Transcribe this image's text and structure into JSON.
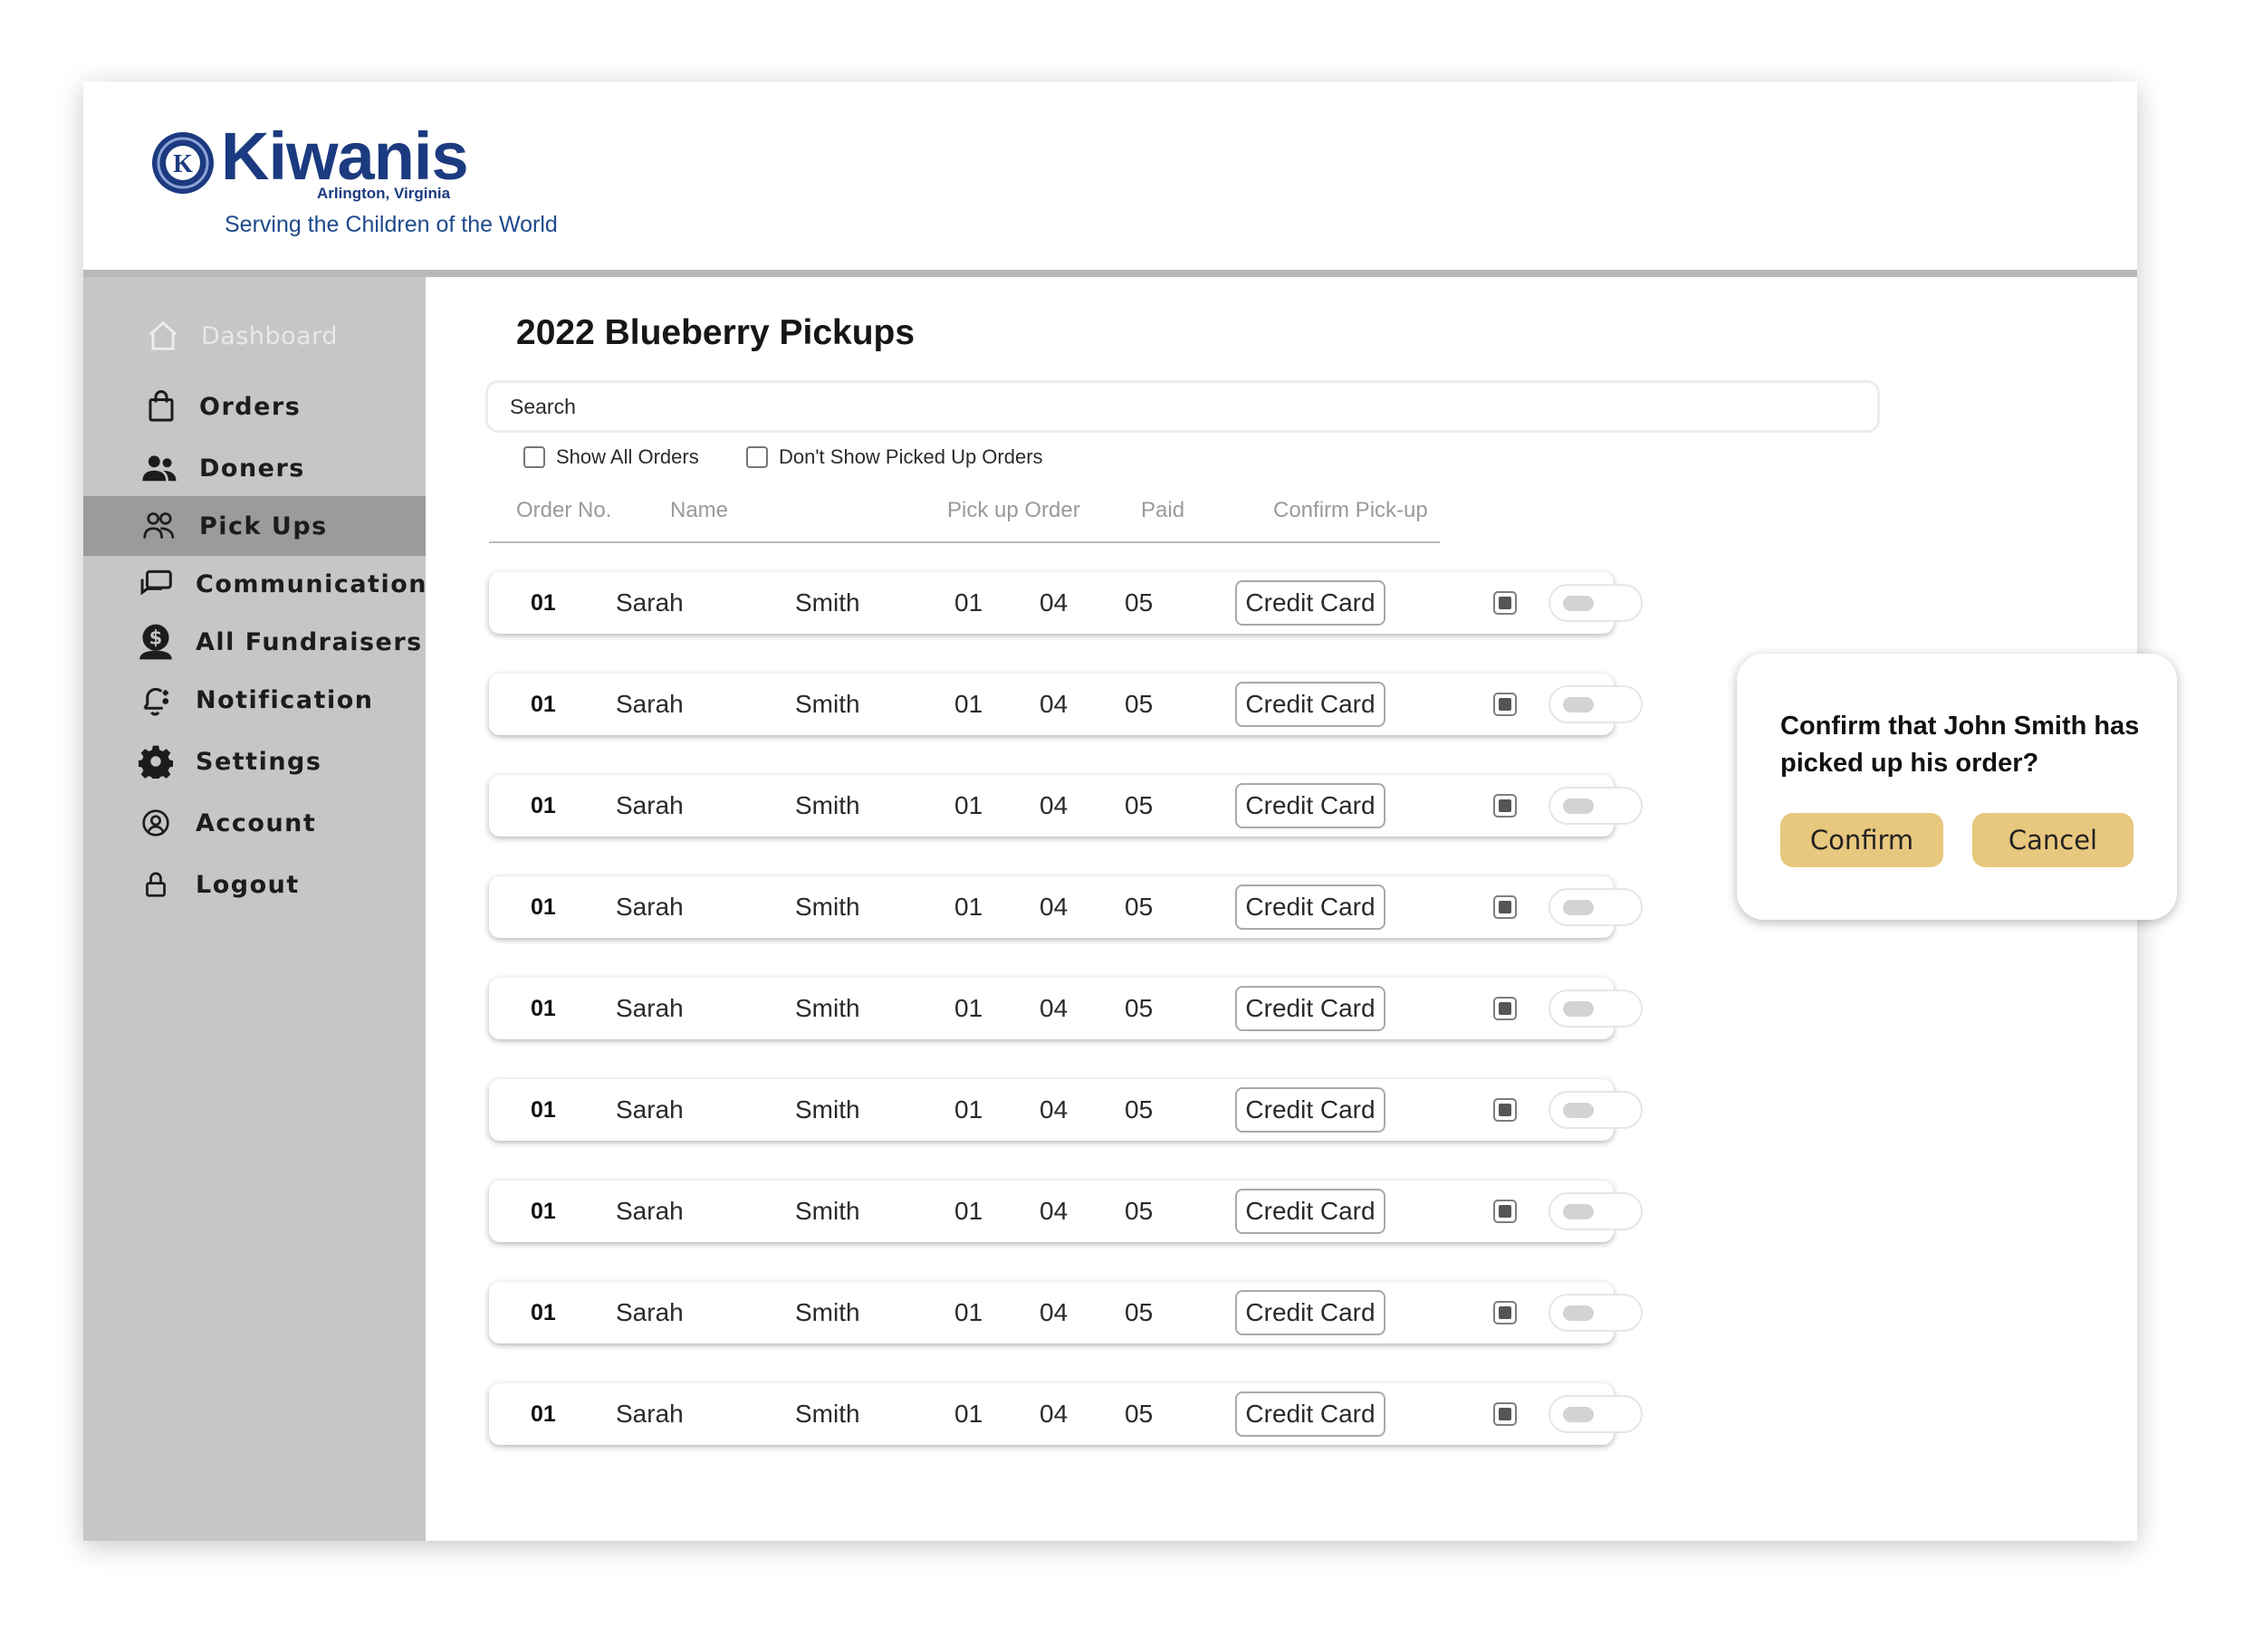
{
  "brand": {
    "name": "Kiwanis",
    "location": "Arlington, Virginia",
    "tagline": "Serving the Children of the World",
    "color": "#1b3a80"
  },
  "sidebar": {
    "items": [
      {
        "label": "Dashboard",
        "icon": "home-icon"
      },
      {
        "label": "Orders",
        "icon": "shopping-bag-icon"
      },
      {
        "label": "Doners",
        "icon": "users-icon"
      },
      {
        "label": "Pick Ups",
        "icon": "pickup-people-icon",
        "active": true
      },
      {
        "label": "Communication",
        "icon": "chat-icon"
      },
      {
        "label": "All Fundraisers",
        "icon": "fundraiser-icon"
      },
      {
        "label": "Notification",
        "icon": "bell-icon"
      },
      {
        "label": "Settings",
        "icon": "gear-icon"
      },
      {
        "label": "Account",
        "icon": "account-icon"
      },
      {
        "label": "Logout",
        "icon": "lock-icon"
      }
    ]
  },
  "main": {
    "title": "2022 Blueberry Pickups",
    "search_placeholder": "Search",
    "filters": [
      "Show All Orders",
      "Don't Show Picked Up Orders"
    ],
    "columns": [
      "Order No.",
      "Name",
      "Pick up Order",
      "Paid",
      "Confirm Pick-up"
    ],
    "rows": [
      {
        "order_no": "01",
        "first": "Sarah",
        "last": "Smith",
        "q1": "01",
        "q2": "04",
        "q3": "05",
        "payment": "Credit Card"
      },
      {
        "order_no": "01",
        "first": "Sarah",
        "last": "Smith",
        "q1": "01",
        "q2": "04",
        "q3": "05",
        "payment": "Credit Card"
      },
      {
        "order_no": "01",
        "first": "Sarah",
        "last": "Smith",
        "q1": "01",
        "q2": "04",
        "q3": "05",
        "payment": "Credit Card"
      },
      {
        "order_no": "01",
        "first": "Sarah",
        "last": "Smith",
        "q1": "01",
        "q2": "04",
        "q3": "05",
        "payment": "Credit Card"
      },
      {
        "order_no": "01",
        "first": "Sarah",
        "last": "Smith",
        "q1": "01",
        "q2": "04",
        "q3": "05",
        "payment": "Credit Card"
      },
      {
        "order_no": "01",
        "first": "Sarah",
        "last": "Smith",
        "q1": "01",
        "q2": "04",
        "q3": "05",
        "payment": "Credit Card"
      },
      {
        "order_no": "01",
        "first": "Sarah",
        "last": "Smith",
        "q1": "01",
        "q2": "04",
        "q3": "05",
        "payment": "Credit Card"
      },
      {
        "order_no": "01",
        "first": "Sarah",
        "last": "Smith",
        "q1": "01",
        "q2": "04",
        "q3": "05",
        "payment": "Credit Card"
      },
      {
        "order_no": "01",
        "first": "Sarah",
        "last": "Smith",
        "q1": "01",
        "q2": "04",
        "q3": "05",
        "payment": "Credit Card"
      }
    ]
  },
  "dialog": {
    "message": "Confirm that John Smith has picked up his order?",
    "confirm_label": "Confirm",
    "cancel_label": "Cancel",
    "button_color": "#e8c77e"
  }
}
